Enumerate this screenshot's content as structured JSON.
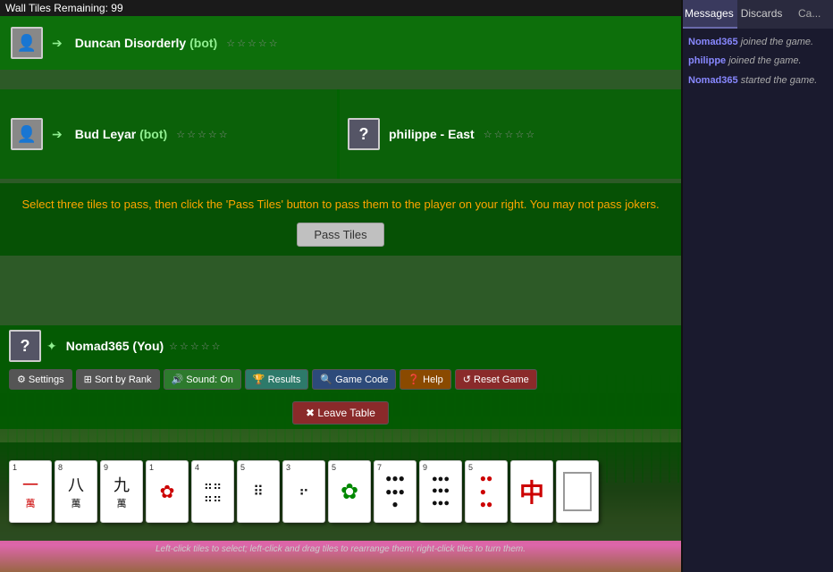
{
  "wall_tiles": {
    "label": "Wall Tiles Remaining:",
    "count": "99"
  },
  "players": {
    "top": {
      "name": "Duncan Disorderly",
      "tag": "(bot)",
      "arrow": "➔",
      "avatar": "👤",
      "stars": [
        "☆",
        "☆",
        "☆",
        "☆",
        "☆"
      ]
    },
    "left": {
      "name": "Bud Leyar",
      "tag": "(bot)",
      "arrow": "➔",
      "avatar": "👤",
      "stars": [
        "☆",
        "☆",
        "☆",
        "☆",
        "☆"
      ]
    },
    "right": {
      "name": "philippe - East",
      "tag": "",
      "arrow": "",
      "avatar": "?",
      "stars": [
        "☆",
        "☆",
        "☆",
        "☆",
        "☆"
      ]
    },
    "bottom": {
      "name": "Nomad365 (You)",
      "tag": "",
      "arrow": "✦",
      "avatar": "?",
      "stars": [
        "☆",
        "☆",
        "☆",
        "☆",
        "☆"
      ]
    }
  },
  "instruction": {
    "text": "Select three tiles to pass, then click the 'Pass Tiles' button to pass them to the player on your right. You may not pass jokers.",
    "pass_btn": "Pass Tiles"
  },
  "buttons": {
    "settings": "⚙ Settings",
    "sort_by_rank": "⊞ Sort by Rank",
    "sound_on": "🔊 Sound: On",
    "results": "🏆 Results",
    "game_code": "🔍 Game Code",
    "help": "❓ Help",
    "reset_game": "↺ Reset Game",
    "leave_game": "✖ Leave Table"
  },
  "tiles": [
    {
      "num": "1",
      "symbol": "一",
      "sub": "萬",
      "color": "red"
    },
    {
      "num": "8",
      "symbol": "八",
      "sub": "萬",
      "color": "black"
    },
    {
      "num": "9",
      "symbol": "九",
      "sub": "萬",
      "color": "black"
    },
    {
      "num": "1",
      "symbol": "🀙",
      "sub": "",
      "color": "red"
    },
    {
      "num": "4",
      "symbol": "⠿",
      "sub": "",
      "color": "black"
    },
    {
      "num": "5",
      "symbol": "⠿",
      "sub": "",
      "color": "black"
    },
    {
      "num": "3",
      "symbol": "⠿",
      "sub": "",
      "color": "black"
    },
    {
      "num": "5",
      "symbol": "⊞",
      "sub": "",
      "color": "green"
    },
    {
      "num": "7",
      "symbol": "⠿",
      "sub": "",
      "color": "black"
    },
    {
      "num": "9",
      "symbol": "⠿",
      "sub": "",
      "color": "black"
    },
    {
      "num": "5",
      "symbol": "⠿",
      "sub": "",
      "color": "red"
    },
    {
      "num": "",
      "symbol": "中",
      "sub": "",
      "color": "red"
    },
    {
      "num": "",
      "symbol": "▭",
      "sub": "",
      "color": "black"
    }
  ],
  "tile_hint": "Left-click tiles to select; left-click and drag tiles to rearrange them; right-click tiles to turn them.",
  "panel": {
    "tabs": [
      "Messages",
      "Discards",
      "Ca..."
    ],
    "active_tab": "Messages",
    "messages": [
      {
        "user": "Nomad365",
        "text": "joined the game.",
        "system": true
      },
      {
        "user": "philippe",
        "text": "joined the game.",
        "system": true
      },
      {
        "user": "Nomad365",
        "text": "started the game.",
        "system": true
      }
    ]
  }
}
